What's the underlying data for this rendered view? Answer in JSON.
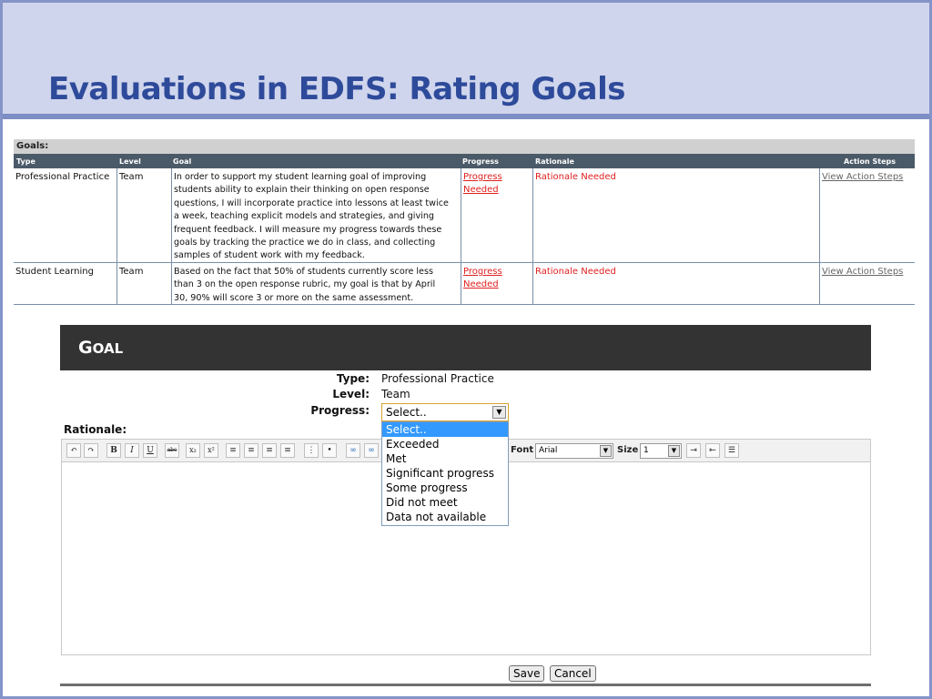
{
  "slide_title": "Evaluations in EDFS: Rating Goals",
  "goals_table": {
    "caption": "Goals:",
    "columns": [
      "Type",
      "Level",
      "Goal",
      "Progress",
      "Rationale",
      "Action Steps"
    ],
    "rows": [
      {
        "type": "Professional Practice",
        "level": "Team",
        "goal_lines": [
          "In order to support my student learning goal of improving",
          "students ability to explain their thinking on open response",
          "questions, I will incorporate practice into lessons at least twice",
          "a week, teaching explicit models and strategies, and giving",
          "frequent feedback. I will measure my progress towards these",
          "goals by tracking the practice we do in class, and collecting",
          "samples of student work with my feedback."
        ],
        "progress_lines": [
          "Progress",
          "Needed"
        ],
        "rationale": "Rationale Needed",
        "action": "View Action Steps"
      },
      {
        "type": "Student Learning",
        "level": "Team",
        "goal_lines": [
          "Based on the fact that 50% of students currently score less",
          "than 3 on the open response rubric, my goal is that by April",
          "30, 90% will score 3 or more on the same assessment."
        ],
        "progress_lines": [
          "Progress",
          "Needed"
        ],
        "rationale": "Rationale Needed",
        "action": "View Action Steps"
      }
    ]
  },
  "goal_panel": {
    "header_first": "G",
    "header_rest": "OAL",
    "type_label": "Type:",
    "type_value": "Professional Practice",
    "level_label": "Level:",
    "level_value": "Team",
    "progress_label": "Progress:",
    "progress_selected": "Select..",
    "progress_options": [
      "Select..",
      "Exceeded",
      "Met",
      "Significant progress",
      "Some progress",
      "Did not meet",
      "Data not available"
    ],
    "rationale_label": "Rationale:",
    "toolbar": {
      "undo": "↶",
      "redo": "↷",
      "bold": "B",
      "italic": "I",
      "underline": "U",
      "strike": "abc",
      "subscript": "x₂",
      "superscript": "x²",
      "font_label": "Font",
      "font_value": "Arial",
      "size_label": "Size",
      "size_value": "1"
    },
    "save_label": "Save",
    "cancel_label": "Cancel"
  },
  "colors": {
    "title": "#2e4a9a",
    "title_band": "#cfd5ec",
    "table_header": "#4b5a68",
    "panel_header": "#333333",
    "alert_red": "#e02020",
    "dropdown_highlight": "#3399ff"
  }
}
